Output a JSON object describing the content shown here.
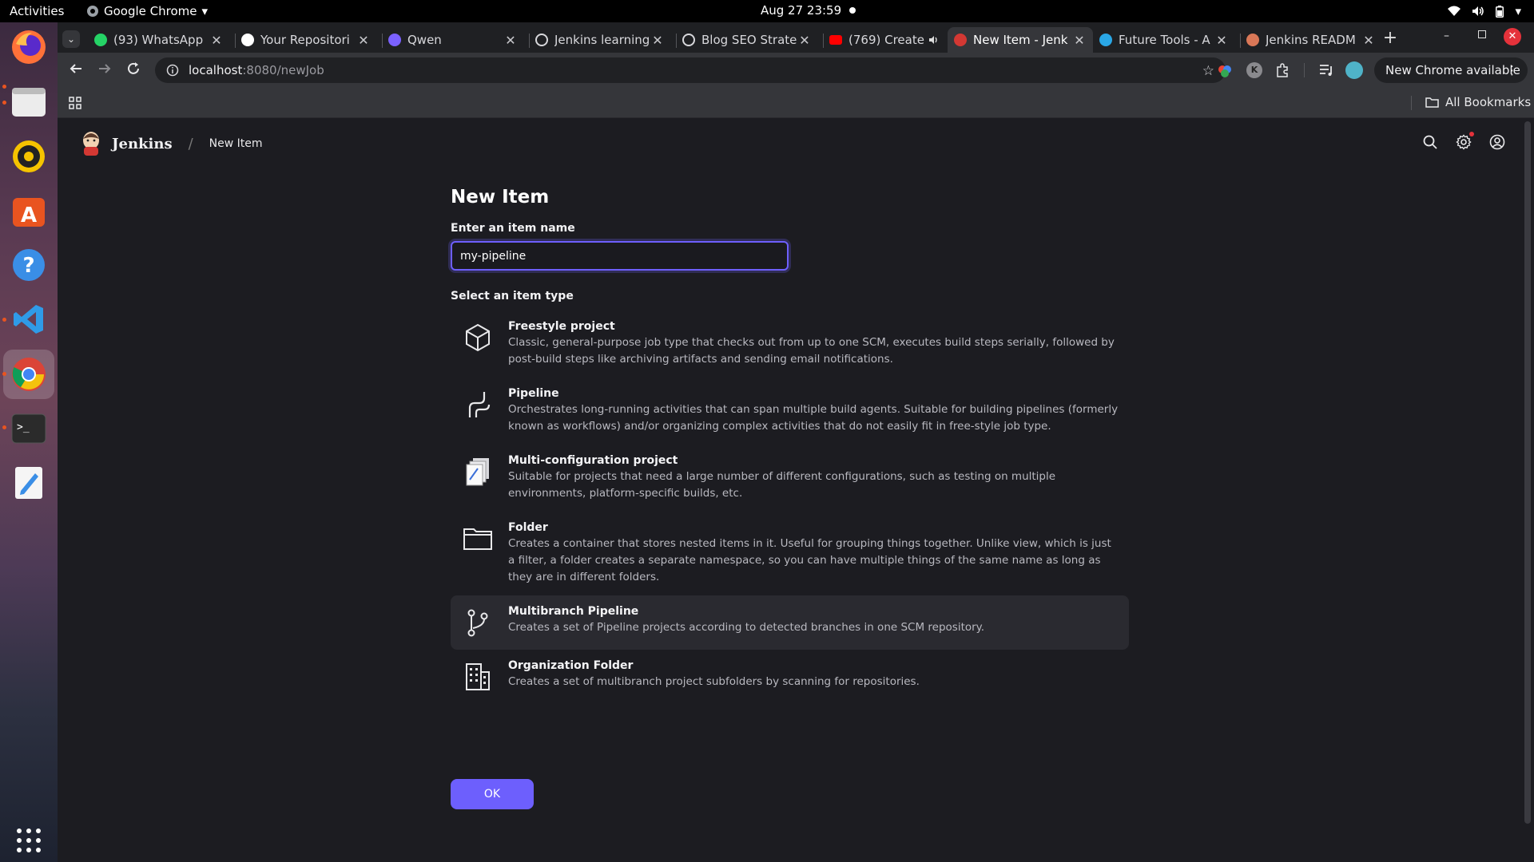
{
  "gnome": {
    "activities": "Activities",
    "app_name": "Google Chrome",
    "datetime": "Aug 27  23:59"
  },
  "tabs": [
    {
      "title": "(93) WhatsApp",
      "icon": "whatsapp-icon",
      "color": "#25d366"
    },
    {
      "title": "Your Repositori",
      "icon": "github-icon",
      "color": "#ffffff"
    },
    {
      "title": "Qwen",
      "icon": "qwen-icon",
      "color": "#7b61ff"
    },
    {
      "title": "Jenkins learning",
      "icon": "openai-icon",
      "color": "#d8d8dc"
    },
    {
      "title": "Blog SEO Strate",
      "icon": "openai-icon",
      "color": "#d8d8dc"
    },
    {
      "title": "(769) Create",
      "icon": "youtube-icon",
      "color": "#ff0000"
    },
    {
      "title": "New Item - Jenk",
      "icon": "jenkins-icon",
      "color": "#d33833"
    },
    {
      "title": "Future Tools - A",
      "icon": "futuretools-icon",
      "color": "#2aa7e6"
    },
    {
      "title": "Jenkins READM",
      "icon": "claude-icon",
      "color": "#d97757"
    }
  ],
  "address": {
    "host": "localhost",
    "path": ":8080/newJob"
  },
  "chrome": {
    "update_label": "New Chrome available",
    "all_bookmarks": "All Bookmarks",
    "profile_initial": "K"
  },
  "jenkins": {
    "brand": "Jenkins",
    "breadcrumb": "New Item",
    "heading": "New Item",
    "name_label": "Enter an item name",
    "name_value": "my-pipeline",
    "type_label": "Select an item type",
    "ok_label": "OK",
    "accent": "#6d5ffd"
  },
  "item_types": [
    {
      "name": "Freestyle project",
      "icon": "freestyle-icon",
      "desc": "Classic, general-purpose job type that checks out from up to one SCM, executes build steps serially, followed by post-build steps like archiving artifacts and sending email notifications."
    },
    {
      "name": "Pipeline",
      "icon": "pipeline-icon",
      "desc": "Orchestrates long-running activities that can span multiple build agents. Suitable for building pipelines (formerly known as workflows) and/or organizing complex activities that do not easily fit in free-style job type."
    },
    {
      "name": "Multi-configuration project",
      "icon": "multiconfig-icon",
      "desc": "Suitable for projects that need a large number of different configurations, such as testing on multiple environments, platform-specific builds, etc."
    },
    {
      "name": "Folder",
      "icon": "folder-icon",
      "desc": "Creates a container that stores nested items in it. Useful for grouping things together. Unlike view, which is just a filter, a folder creates a separate namespace, so you can have multiple things of the same name as long as they are in different folders."
    },
    {
      "name": "Multibranch Pipeline",
      "icon": "branch-icon",
      "desc": "Creates a set of Pipeline projects according to detected branches in one SCM repository."
    },
    {
      "name": "Organization Folder",
      "icon": "building-icon",
      "desc": "Creates a set of multibranch project subfolders by scanning for repositories."
    }
  ]
}
